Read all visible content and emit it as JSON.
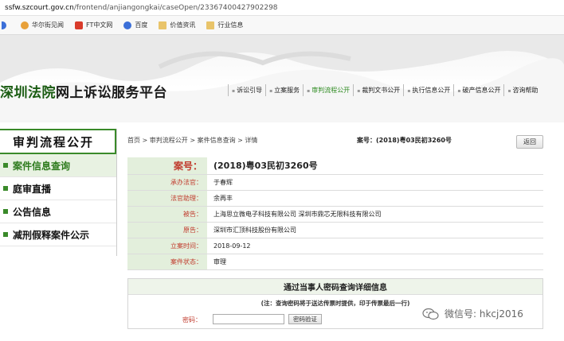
{
  "browser": {
    "url_host": "ssfw.szcourt.gov.cn",
    "url_path": "/frontend/anjiangongkai/caseOpen/23367400427902298",
    "bookmarks": [
      "华尔街见闻",
      "FT中文网",
      "百度",
      "价值资讯",
      "行业信息"
    ]
  },
  "header": {
    "court_name": "深圳法院",
    "platform_name": "网上诉讼服务平台",
    "nav": [
      {
        "label": "诉讼引导",
        "active": false
      },
      {
        "label": "立案服务",
        "active": false
      },
      {
        "label": "审判流程公开",
        "active": true
      },
      {
        "label": "裁判文书公开",
        "active": false
      },
      {
        "label": "执行信息公开",
        "active": false
      },
      {
        "label": "破产信息公开",
        "active": false
      },
      {
        "label": "咨询帮助",
        "active": false
      }
    ]
  },
  "sidebar": {
    "title": "审判流程公开",
    "items": [
      {
        "label": "案件信息查询",
        "active": true
      },
      {
        "label": "庭审直播",
        "active": false
      },
      {
        "label": "公告信息",
        "active": false
      },
      {
        "label": "减刑假释案件公示",
        "active": false
      }
    ]
  },
  "main": {
    "breadcrumb": "首页 > 审判流程公开 > 案件信息查询 > 详情",
    "case_no_top": "案号：(2018)粤03民初3260号",
    "back_label": "返回",
    "rows": [
      {
        "label": "案号：",
        "value": "(2018)粤03民初3260号"
      },
      {
        "label": "承办法官：",
        "value": "于春辉"
      },
      {
        "label": "法官助理：",
        "value": "余再丰"
      },
      {
        "label": "被告：",
        "value": "上海思立微电子科技有限公司  深圳市鼎芯无限科技有限公司"
      },
      {
        "label": "原告：",
        "value": "深圳市汇顶科技股份有限公司"
      },
      {
        "label": "立案时间：",
        "value": "2018-09-12"
      },
      {
        "label": "案件状态：",
        "value": "审理"
      }
    ],
    "password_query": {
      "title": "通过当事人密码查询详细信息",
      "note": "(注：查询密码将于送达传票时提供，印于传票最后一行)",
      "label": "密码：",
      "input_value": "",
      "button_label": "密码验证"
    }
  },
  "watermark": {
    "text": "微信号: hkcj2016"
  },
  "colors": {
    "accent_green": "#3a8a2a",
    "label_red": "#c0392b",
    "label_bg": "#e3efdc"
  }
}
